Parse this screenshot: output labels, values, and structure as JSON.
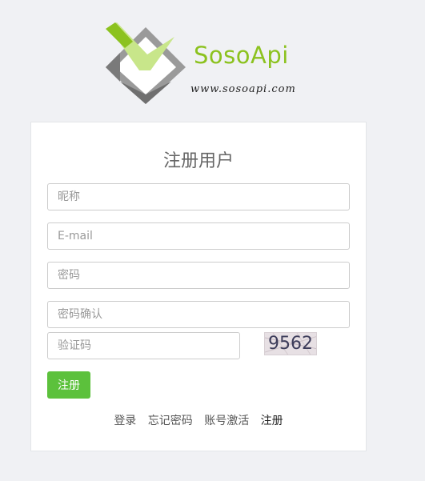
{
  "brand": {
    "name": "SosoApi",
    "url": "www.sosoapi.com",
    "accent_color": "#8cc21f"
  },
  "form": {
    "title": "注册用户",
    "nickname_placeholder": "昵称",
    "email_placeholder": "E-mail",
    "password_placeholder": "密码",
    "password_confirm_placeholder": "密码确认",
    "captcha_placeholder": "验证码",
    "captcha_text": "9562",
    "submit_label": "注册",
    "submit_color": "#5cc13c"
  },
  "links": {
    "login": "登录",
    "forgot_password": "忘记密码",
    "activate_account": "账号激活",
    "register": "注册"
  }
}
